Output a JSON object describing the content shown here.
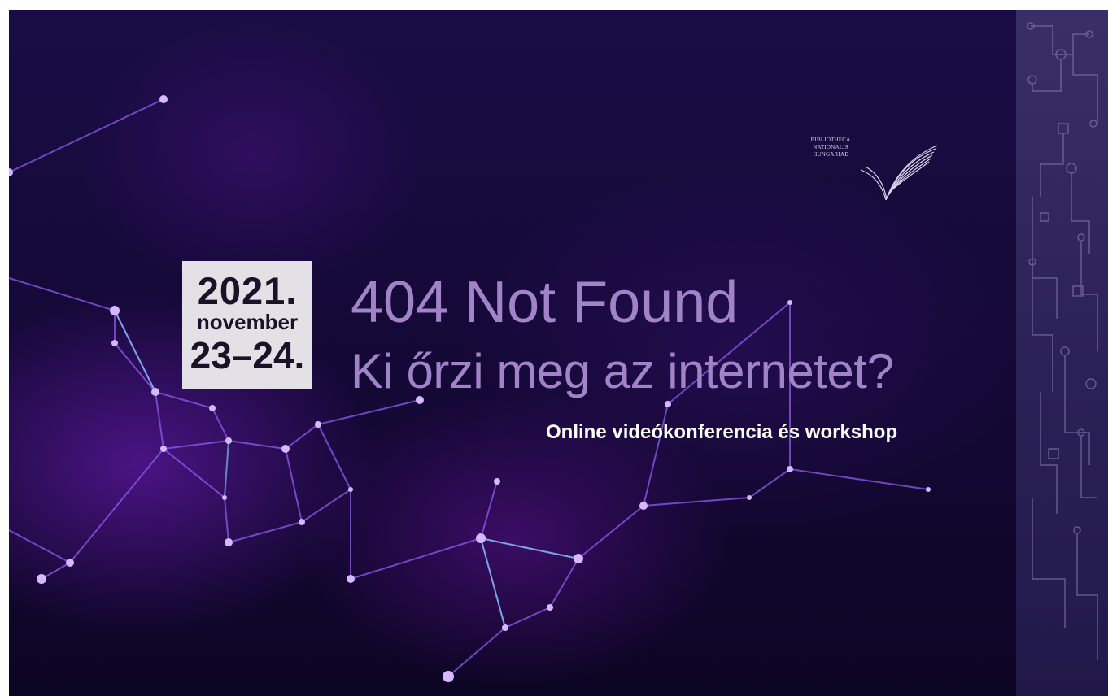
{
  "banner": {
    "date": {
      "year": "2021.",
      "month": "november",
      "days": "23–24."
    },
    "title_line_1": "404 Not Found",
    "title_line_2": "Ki őrzi meg az internetet?",
    "subtitle": "Online videókonferencia és workshop",
    "logo": {
      "lines": [
        "BIBLIOTHECA",
        "NATIONALIS",
        "HUNGARIAE"
      ]
    }
  },
  "colors": {
    "background": "#140835",
    "title": "#a184c8",
    "subtitle": "#ffffff",
    "date_box": "#e4e1e6",
    "date_text": "#1a1226",
    "network_line": "#8e5cf0",
    "network_node": "#d6b8ff",
    "circuit_panel": "#2b2257"
  }
}
